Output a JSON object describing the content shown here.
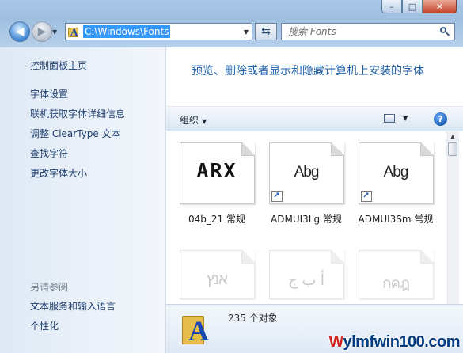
{
  "window": {
    "min_glyph": "–",
    "max_glyph": "□",
    "close_glyph": "✕"
  },
  "nav": {
    "back_glyph": "◀",
    "forward_glyph": "▶",
    "history_glyph": "▼"
  },
  "address": {
    "path": "C:\\Windows\\Fonts",
    "icon": "fonts-folder-icon",
    "drop_glyph": "▼",
    "refresh_glyph": "⇆"
  },
  "search": {
    "placeholder": "搜索 Fonts",
    "icon": "search-icon"
  },
  "sidebar": {
    "home": "控制面板主页",
    "items": [
      "字体设置",
      "联机获取字体详细信息",
      "调整 ClearType 文本",
      "查找字符",
      "更改字体大小"
    ],
    "see_also_heading": "另请参阅",
    "see_also": [
      "文本服务和输入语言",
      "个性化"
    ]
  },
  "main": {
    "description": "预览、删除或者显示和隐藏计算机上安装的字体"
  },
  "toolbar": {
    "organize": "组织",
    "organize_arrow": "▼",
    "views_arrow": "▼",
    "help": "?"
  },
  "fonts": [
    {
      "name": "04b_21 常规",
      "preview": "ARX",
      "shortcut": false
    },
    {
      "name": "ADMUI3Lg 常规",
      "preview": "Abg",
      "shortcut": true
    },
    {
      "name": "ADMUI3Sm 常规",
      "preview": "Abg",
      "shortcut": true
    },
    {
      "name": "",
      "preview": "אנץ",
      "shortcut": false
    },
    {
      "name": "",
      "preview": "ﺃ ﺏ ﺝ",
      "shortcut": false
    },
    {
      "name": "",
      "preview": "กคฎ",
      "shortcut": false
    }
  ],
  "shortcut_glyph": "↗",
  "scroll_up_glyph": "▲",
  "details": {
    "count": "235 个对象",
    "icon": "fonts-folder-icon"
  },
  "watermark": {
    "logo": "W",
    "text": "ylmfwin100.com"
  }
}
